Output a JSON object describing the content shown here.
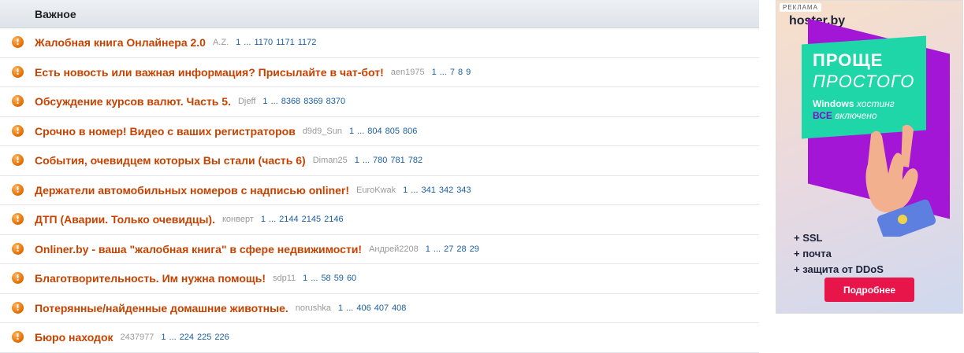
{
  "section": {
    "title": "Важное"
  },
  "topics": [
    {
      "title": "Жалобная книга Онлайнера 2.0",
      "author": "A.Z.",
      "pages": [
        "1",
        "...",
        "1170",
        "1171",
        "1172"
      ]
    },
    {
      "title": "Есть новость или важная информация? Присылайте в чат-бот!",
      "author": "aen1975",
      "pages": [
        "1",
        "...",
        "7",
        "8",
        "9"
      ]
    },
    {
      "title": "Обсуждение курсов валют. Часть 5.",
      "author": "Djeff",
      "pages": [
        "1",
        "...",
        "8368",
        "8369",
        "8370"
      ]
    },
    {
      "title": "Срочно в номер! Видео с ваших регистраторов",
      "author": "d9d9_Sun",
      "pages": [
        "1",
        "...",
        "804",
        "805",
        "806"
      ]
    },
    {
      "title": "События, очевидцем которых Вы стали (часть 6)",
      "author": "Diman25",
      "pages": [
        "1",
        "...",
        "780",
        "781",
        "782"
      ]
    },
    {
      "title": "Держатели автомобильных номеров с надписью onliner!",
      "author": "EuroKwak",
      "pages": [
        "1",
        "...",
        "341",
        "342",
        "343"
      ]
    },
    {
      "title": "ДТП (Аварии. Только очевидцы).",
      "author": "конверт",
      "pages": [
        "1",
        "...",
        "2144",
        "2145",
        "2146"
      ]
    },
    {
      "title": "Onliner.by - ваша \"жалобная книга\" в сфере недвижимости!",
      "author": "Андрей2208",
      "pages": [
        "1",
        "...",
        "27",
        "28",
        "29"
      ]
    },
    {
      "title": "Благотворительность. Им нужна помощь!",
      "author": "sdp11",
      "pages": [
        "1",
        "...",
        "58",
        "59",
        "60"
      ]
    },
    {
      "title": "Потерянные/найденные домашние животные.",
      "author": "norushka",
      "pages": [
        "1",
        "...",
        "406",
        "407",
        "408"
      ]
    },
    {
      "title": "Бюро находок",
      "author": "2437977",
      "pages": [
        "1",
        "...",
        "224",
        "225",
        "226"
      ]
    }
  ],
  "ad": {
    "label": "РЕКЛАМА",
    "logo": "hoster.by",
    "headline1": "ПРОЩЕ",
    "headline2": "ПРОСТОГО",
    "sub1_bold": "Windows",
    "sub1_rest": "хостинг",
    "sub2_bold": "ВСЕ",
    "sub2_rest": "включено",
    "features": [
      "+ SSL",
      "+ почта",
      "+ защита от DDoS"
    ],
    "button": "Подробнее",
    "colors": {
      "green": "#1ed6a8",
      "purple": "#a416d6",
      "button": "#e8154a"
    }
  },
  "colors": {
    "topic_title": "#c64200",
    "page_link": "#1a5fa0",
    "icon": "#e26b00"
  }
}
